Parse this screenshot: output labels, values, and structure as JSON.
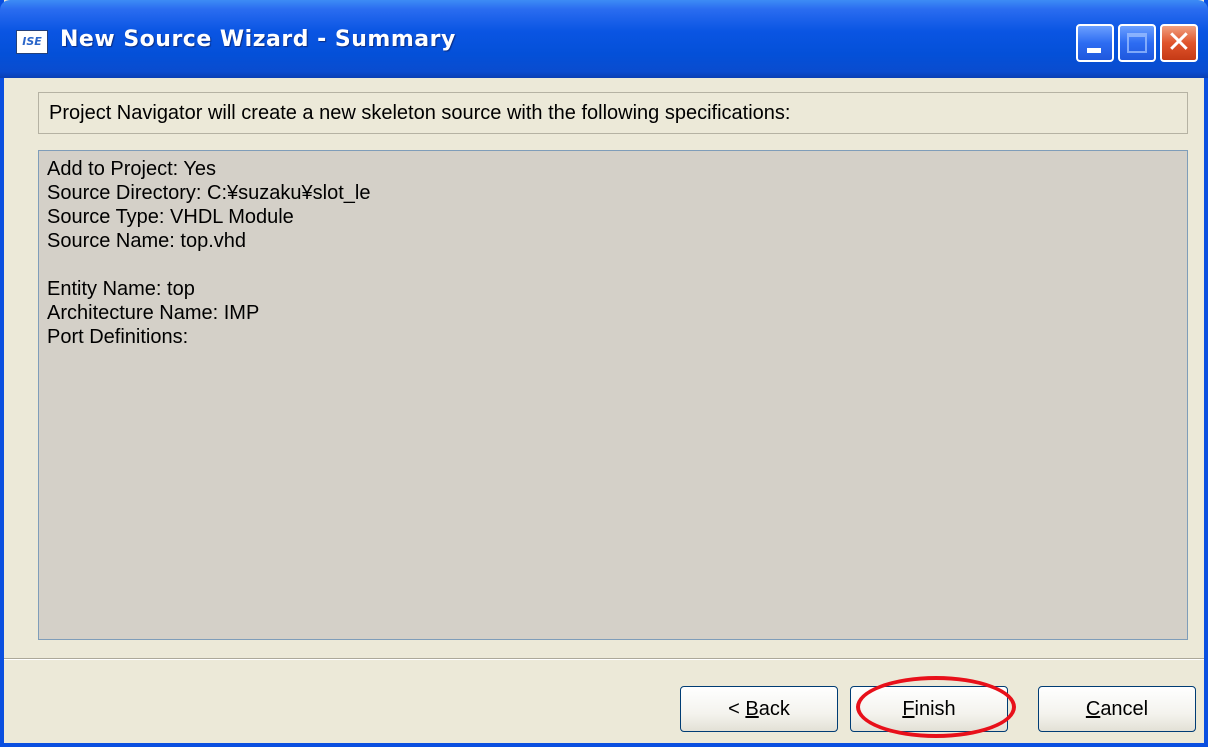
{
  "window": {
    "title": "New Source Wizard - Summary",
    "app_icon_text": "ISE"
  },
  "intro_text": "Project Navigator will create a new skeleton source with the following specifications:",
  "summary": {
    "add_to_project": "Add to Project: Yes",
    "source_directory": "Source Directory: C:¥suzaku¥slot_le",
    "source_type": "Source Type: VHDL Module",
    "source_name": "Source Name: top.vhd",
    "entity_name": "Entity Name: top",
    "architecture_name": "Architecture Name: IMP",
    "port_definitions": "Port Definitions:"
  },
  "buttons": {
    "back_prefix": "< ",
    "back_accel": "B",
    "back_rest": "ack",
    "finish_accel": "F",
    "finish_rest": "inish",
    "cancel_accel": "C",
    "cancel_rest": "ancel"
  },
  "colors": {
    "titlebar": "#0a55e3",
    "dialog_bg": "#ece9d8",
    "summary_bg": "#d4d0c8",
    "highlight": "#e8101a"
  },
  "icons": [
    "ise-app-icon",
    "minimize-icon",
    "maximize-icon",
    "close-icon"
  ]
}
